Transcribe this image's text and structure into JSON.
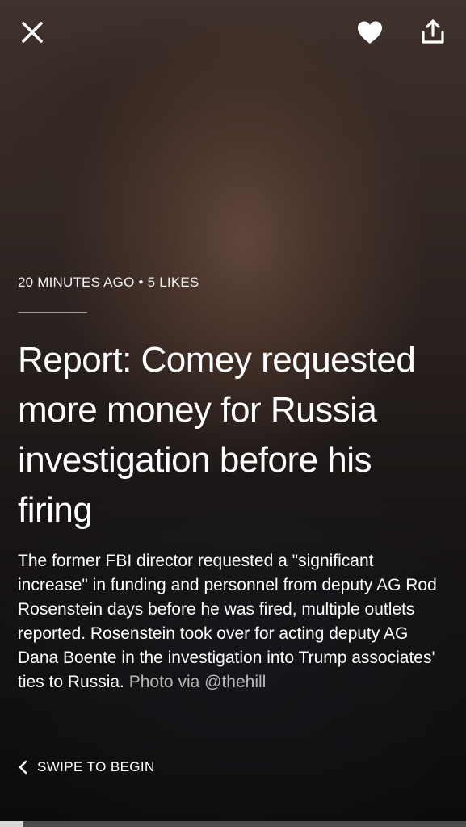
{
  "article": {
    "time_ago": "20 MINUTES AGO",
    "separator": "•",
    "likes": "5 LIKES",
    "headline": "Report: Comey requested more money for Russia investigation before his firing",
    "summary": "The former FBI director requested a \"significant increase\" in funding and personnel from deputy AG Rod Rosenstein days before he was fired, multiple outlets reported. Rosenstein took over for acting deputy AG Dana Boente in the investigation into Trump associates' ties to Russia. ",
    "photo_credit": "Photo via @thehill"
  },
  "actions": {
    "swipe_label": "SWIPE TO BEGIN"
  },
  "icons": {
    "close": "close-icon",
    "like": "heart-icon",
    "share": "share-icon",
    "swipe": "chevron-left-icon"
  },
  "progress": {
    "fraction": 0.05
  }
}
